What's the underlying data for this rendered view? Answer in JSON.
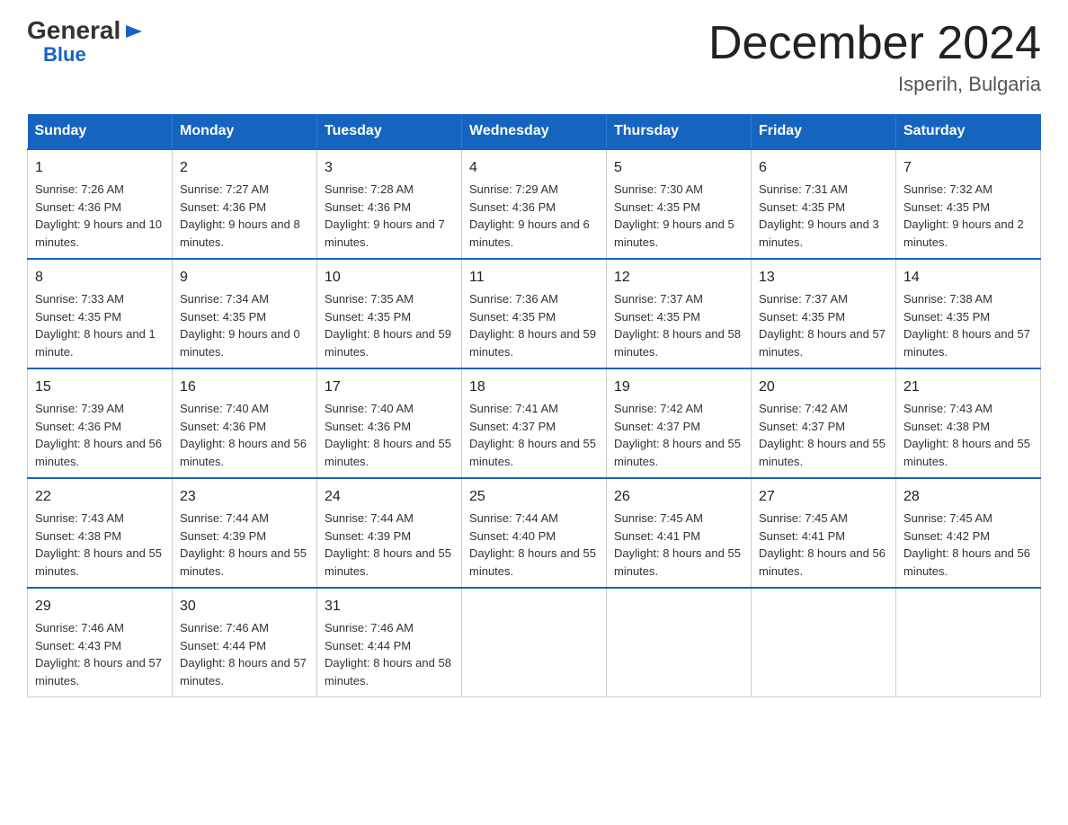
{
  "logo": {
    "general": "General",
    "arrow": "▶",
    "blue": "Blue"
  },
  "title": "December 2024",
  "subtitle": "Isperih, Bulgaria",
  "days_of_week": [
    "Sunday",
    "Monday",
    "Tuesday",
    "Wednesday",
    "Thursday",
    "Friday",
    "Saturday"
  ],
  "weeks": [
    [
      {
        "day": "1",
        "sunrise": "7:26 AM",
        "sunset": "4:36 PM",
        "daylight": "9 hours and 10 minutes."
      },
      {
        "day": "2",
        "sunrise": "7:27 AM",
        "sunset": "4:36 PM",
        "daylight": "9 hours and 8 minutes."
      },
      {
        "day": "3",
        "sunrise": "7:28 AM",
        "sunset": "4:36 PM",
        "daylight": "9 hours and 7 minutes."
      },
      {
        "day": "4",
        "sunrise": "7:29 AM",
        "sunset": "4:36 PM",
        "daylight": "9 hours and 6 minutes."
      },
      {
        "day": "5",
        "sunrise": "7:30 AM",
        "sunset": "4:35 PM",
        "daylight": "9 hours and 5 minutes."
      },
      {
        "day": "6",
        "sunrise": "7:31 AM",
        "sunset": "4:35 PM",
        "daylight": "9 hours and 3 minutes."
      },
      {
        "day": "7",
        "sunrise": "7:32 AM",
        "sunset": "4:35 PM",
        "daylight": "9 hours and 2 minutes."
      }
    ],
    [
      {
        "day": "8",
        "sunrise": "7:33 AM",
        "sunset": "4:35 PM",
        "daylight": "8 hours and 1 minute."
      },
      {
        "day": "9",
        "sunrise": "7:34 AM",
        "sunset": "4:35 PM",
        "daylight": "9 hours and 0 minutes."
      },
      {
        "day": "10",
        "sunrise": "7:35 AM",
        "sunset": "4:35 PM",
        "daylight": "8 hours and 59 minutes."
      },
      {
        "day": "11",
        "sunrise": "7:36 AM",
        "sunset": "4:35 PM",
        "daylight": "8 hours and 59 minutes."
      },
      {
        "day": "12",
        "sunrise": "7:37 AM",
        "sunset": "4:35 PM",
        "daylight": "8 hours and 58 minutes."
      },
      {
        "day": "13",
        "sunrise": "7:37 AM",
        "sunset": "4:35 PM",
        "daylight": "8 hours and 57 minutes."
      },
      {
        "day": "14",
        "sunrise": "7:38 AM",
        "sunset": "4:35 PM",
        "daylight": "8 hours and 57 minutes."
      }
    ],
    [
      {
        "day": "15",
        "sunrise": "7:39 AM",
        "sunset": "4:36 PM",
        "daylight": "8 hours and 56 minutes."
      },
      {
        "day": "16",
        "sunrise": "7:40 AM",
        "sunset": "4:36 PM",
        "daylight": "8 hours and 56 minutes."
      },
      {
        "day": "17",
        "sunrise": "7:40 AM",
        "sunset": "4:36 PM",
        "daylight": "8 hours and 55 minutes."
      },
      {
        "day": "18",
        "sunrise": "7:41 AM",
        "sunset": "4:37 PM",
        "daylight": "8 hours and 55 minutes."
      },
      {
        "day": "19",
        "sunrise": "7:42 AM",
        "sunset": "4:37 PM",
        "daylight": "8 hours and 55 minutes."
      },
      {
        "day": "20",
        "sunrise": "7:42 AM",
        "sunset": "4:37 PM",
        "daylight": "8 hours and 55 minutes."
      },
      {
        "day": "21",
        "sunrise": "7:43 AM",
        "sunset": "4:38 PM",
        "daylight": "8 hours and 55 minutes."
      }
    ],
    [
      {
        "day": "22",
        "sunrise": "7:43 AM",
        "sunset": "4:38 PM",
        "daylight": "8 hours and 55 minutes."
      },
      {
        "day": "23",
        "sunrise": "7:44 AM",
        "sunset": "4:39 PM",
        "daylight": "8 hours and 55 minutes."
      },
      {
        "day": "24",
        "sunrise": "7:44 AM",
        "sunset": "4:39 PM",
        "daylight": "8 hours and 55 minutes."
      },
      {
        "day": "25",
        "sunrise": "7:44 AM",
        "sunset": "4:40 PM",
        "daylight": "8 hours and 55 minutes."
      },
      {
        "day": "26",
        "sunrise": "7:45 AM",
        "sunset": "4:41 PM",
        "daylight": "8 hours and 55 minutes."
      },
      {
        "day": "27",
        "sunrise": "7:45 AM",
        "sunset": "4:41 PM",
        "daylight": "8 hours and 56 minutes."
      },
      {
        "day": "28",
        "sunrise": "7:45 AM",
        "sunset": "4:42 PM",
        "daylight": "8 hours and 56 minutes."
      }
    ],
    [
      {
        "day": "29",
        "sunrise": "7:46 AM",
        "sunset": "4:43 PM",
        "daylight": "8 hours and 57 minutes."
      },
      {
        "day": "30",
        "sunrise": "7:46 AM",
        "sunset": "4:44 PM",
        "daylight": "8 hours and 57 minutes."
      },
      {
        "day": "31",
        "sunrise": "7:46 AM",
        "sunset": "4:44 PM",
        "daylight": "8 hours and 58 minutes."
      },
      {
        "day": "",
        "sunrise": "",
        "sunset": "",
        "daylight": ""
      },
      {
        "day": "",
        "sunrise": "",
        "sunset": "",
        "daylight": ""
      },
      {
        "day": "",
        "sunrise": "",
        "sunset": "",
        "daylight": ""
      },
      {
        "day": "",
        "sunrise": "",
        "sunset": "",
        "daylight": ""
      }
    ]
  ]
}
